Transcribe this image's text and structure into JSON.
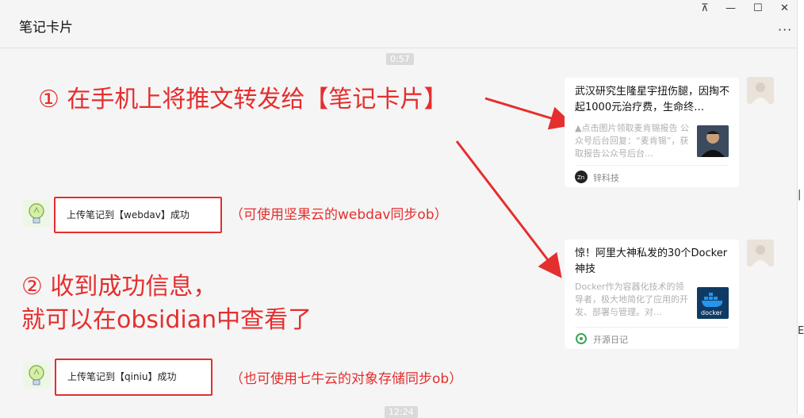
{
  "window": {
    "title": "笔记卡片",
    "pin_symbol": "⊼",
    "minimize_symbol": "—",
    "maximize_symbol": "☐",
    "close_symbol": "✕",
    "more_symbol": "···"
  },
  "right_strip": {
    "mark_1": "|",
    "mark_2": "E/"
  },
  "timestamps": {
    "top": "0:57",
    "bottom": "12:24"
  },
  "annotations": {
    "step1": "① 在手机上将推文转发给【笔记卡片】",
    "step2_line1": "② 收到成功信息，",
    "step2_line2": "就可以在obsidian中查看了",
    "note1": "（可使用坚果云的webdav同步ob）",
    "note2": "（也可使用七牛云的对象存储同步ob）"
  },
  "messages": [
    {
      "text": "上传笔记到【webdav】成功"
    },
    {
      "text": "上传笔记到【qiniu】成功"
    }
  ],
  "cards": [
    {
      "title": "武汉研究生隆星宇扭伤腿，因掏不起1000元治疗费，生命终…",
      "desc": "▲点击图片领取麦肯锡报告 公众号后台回复：“麦肯锡”，获取报告公众号后台…",
      "source": "锌科技",
      "thumb_icon": "person-photo",
      "source_icon": "zn-logo-icon"
    },
    {
      "title": "惊！阿里大神私发的30个Docker神技",
      "desc": "Docker作为容器化技术的领导者，极大地简化了应用的开发、部署与管理。对…",
      "source": "开源日记",
      "thumb_icon": "docker-logo",
      "thumb_text": "docker",
      "source_icon": "github-icon"
    }
  ],
  "colors": {
    "accent_red": "#e52e2e",
    "background": "#f5f5f5",
    "card_bg": "#ffffff",
    "docker_bg": "#0f3a64"
  }
}
